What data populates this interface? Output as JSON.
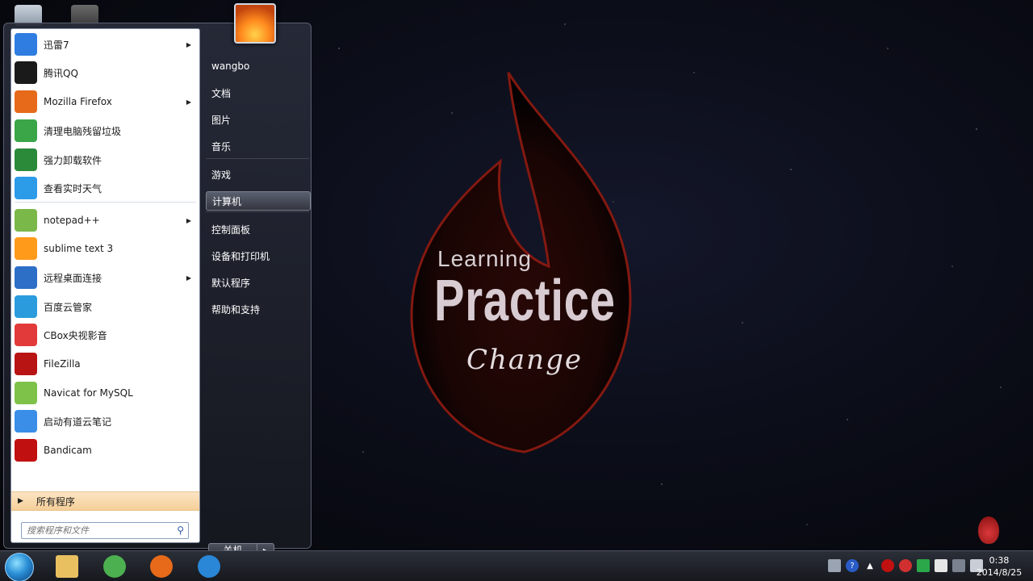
{
  "desktop": {
    "logo_line1": "Learning",
    "logo_line2": "Practice",
    "logo_line3": "Change"
  },
  "start_menu": {
    "programs": [
      {
        "label": "迅雷7",
        "icon": "xunlei-icon",
        "color": "#2f7de1",
        "has_arrow": true
      },
      {
        "label": "腾讯QQ",
        "icon": "qq-icon",
        "color": "#1a1a1a",
        "has_arrow": false
      },
      {
        "label": "Mozilla Firefox",
        "icon": "firefox-icon",
        "color": "#e66a1a",
        "has_arrow": true
      },
      {
        "label": "清理电脑残留垃圾",
        "icon": "recycle-icon",
        "color": "#3aa648",
        "has_arrow": false
      },
      {
        "label": "强力卸载软件",
        "icon": "uninstall-icon",
        "color": "#2a8a3a",
        "has_arrow": false
      },
      {
        "label": "查看实时天气",
        "icon": "weather-icon",
        "color": "#2c9be8",
        "has_arrow": false
      },
      {
        "label": "notepad++",
        "icon": "notepad-icon",
        "color": "#7bb84a",
        "has_arrow": true
      },
      {
        "label": "sublime text 3",
        "icon": "sublime-icon",
        "color": "#ff9a1a",
        "has_arrow": false
      },
      {
        "label": "远程桌面连接",
        "icon": "remote-desktop-icon",
        "color": "#2d6fc7",
        "has_arrow": true
      },
      {
        "label": "百度云管家",
        "icon": "baidu-cloud-icon",
        "color": "#2a9cdd",
        "has_arrow": false
      },
      {
        "label": "CBox央视影音",
        "icon": "cbox-icon",
        "color": "#e23a3a",
        "has_arrow": false
      },
      {
        "label": "FileZilla",
        "icon": "filezilla-icon",
        "color": "#b81414",
        "has_arrow": false
      },
      {
        "label": "Navicat for MySQL",
        "icon": "navicat-icon",
        "color": "#7ec24a",
        "has_arrow": false
      },
      {
        "label": "启动有道云笔记",
        "icon": "youdao-note-icon",
        "color": "#3a8ee8",
        "has_arrow": false
      },
      {
        "label": "Bandicam",
        "icon": "bandicam-icon",
        "color": "#c01010",
        "has_arrow": false
      }
    ],
    "all_programs_label": "所有程序",
    "search_placeholder": "搜索程序和文件",
    "right_items": [
      {
        "label": "wangbo",
        "name": "user-name"
      },
      {
        "label": "文档",
        "name": "documents"
      },
      {
        "label": "图片",
        "name": "pictures"
      },
      {
        "label": "音乐",
        "name": "music"
      },
      {
        "label": "游戏",
        "name": "games"
      },
      {
        "label": "计算机",
        "name": "computer"
      },
      {
        "label": "控制面板",
        "name": "control-panel"
      },
      {
        "label": "设备和打印机",
        "name": "devices-printers"
      },
      {
        "label": "默认程序",
        "name": "default-programs"
      },
      {
        "label": "帮助和支持",
        "name": "help-support"
      }
    ],
    "shutdown_label": "关机"
  },
  "taskbar": {
    "apps": [
      {
        "name": "explorer-icon",
        "color": "#e8c060"
      },
      {
        "name": "chrome-icon",
        "color": "#4caf50"
      },
      {
        "name": "firefox-icon",
        "color": "#e66a1a"
      },
      {
        "name": "ie-icon",
        "color": "#2a86d6"
      }
    ],
    "clock_time": "0:38",
    "clock_date": "2014/8/25"
  }
}
